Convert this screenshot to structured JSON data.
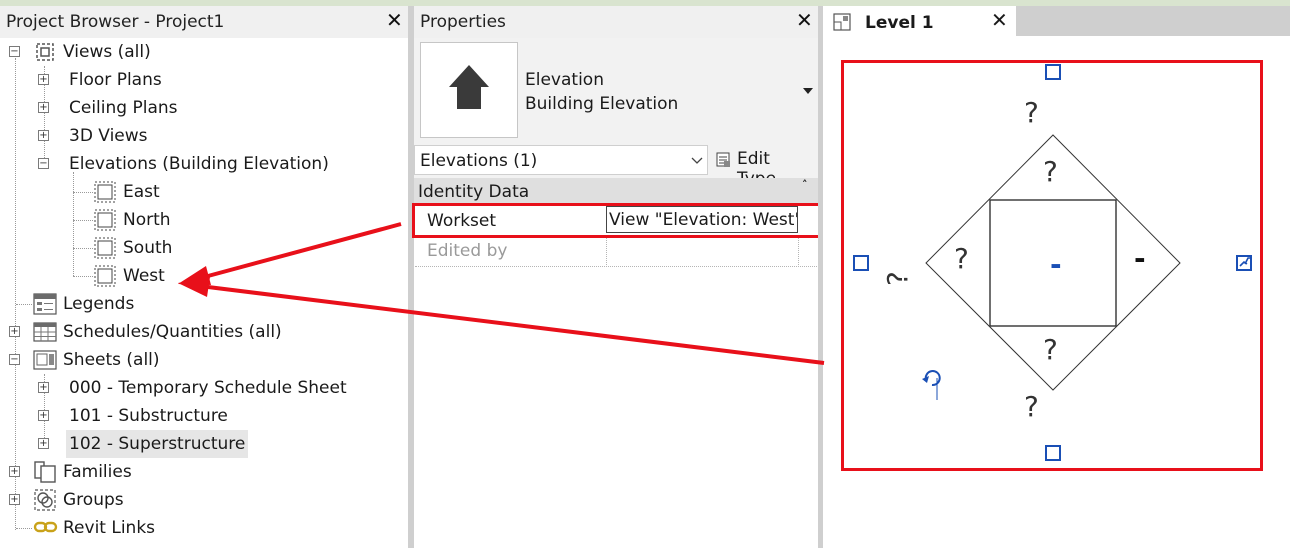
{
  "project_browser": {
    "title": "Project Browser - Project1",
    "tree": {
      "views_all": "Views (all)",
      "floor_plans": "Floor Plans",
      "ceiling_plans": "Ceiling Plans",
      "3d_views": "3D Views",
      "elevations": "Elevations (Building Elevation)",
      "east": "East",
      "north": "North",
      "south": "South",
      "west": "West",
      "legends": "Legends",
      "schedules": "Schedules/Quantities (all)",
      "sheets": "Sheets (all)",
      "sheet_000": "000 - Temporary Schedule Sheet",
      "sheet_101": "101 - Substructure",
      "sheet_102": "102 - Superstructure",
      "families": "Families",
      "groups": "Groups",
      "revit_links": "Revit Links"
    }
  },
  "properties": {
    "title": "Properties",
    "type_name": "Elevation",
    "type_subname": "Building Elevation",
    "selector_value": "Elevations (1)",
    "edit_type_label": "Edit Type",
    "section": "Identity Data",
    "rows": [
      {
        "label": "Workset",
        "value": "View \"Elevation: West\""
      },
      {
        "label": "Edited by",
        "value": ""
      }
    ]
  },
  "view_tab": {
    "title": "Level 1",
    "marker_question": "?",
    "marker_dash": "-"
  },
  "colors": {
    "highlight_red": "#e8101a",
    "selection_blue": "#1a4fb5",
    "header_gray": "#f0f0f0"
  }
}
